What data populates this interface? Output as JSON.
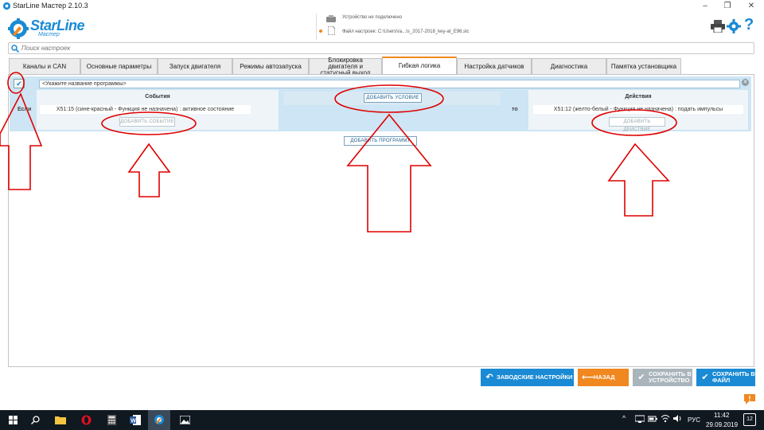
{
  "window": {
    "title": "StarLine Мастер 2.10.3",
    "controls": {
      "minimize": "–",
      "maximize": "❐",
      "close": "✕"
    }
  },
  "brand": {
    "name": "StarLine",
    "subtitle": "Мастер"
  },
  "device": {
    "status": "Устройство не подключено",
    "file_label": "Файл настроек: C:\\Users\\ra...\\s_2017-2018_key-at_E96.slc"
  },
  "search": {
    "placeholder": "Поиск настроек"
  },
  "tabs": [
    {
      "label": "Каналы и CAN"
    },
    {
      "label": "Основные параметры"
    },
    {
      "label": "Запуск двигателя"
    },
    {
      "label": "Режимы автозапуска"
    },
    {
      "label": "Блокировка двигателя и статусный выход"
    },
    {
      "label": "Гибкая логика",
      "active": true
    },
    {
      "label": "Настройка датчиков"
    },
    {
      "label": "Диагностика"
    },
    {
      "label": "Памятка установщика"
    }
  ],
  "program": {
    "name_placeholder": "<Укажите название программы>",
    "if_label": "Если",
    "then_label": "то",
    "events": {
      "header": "События",
      "item": "X51:15 (сине-красный - Функция не назначена) : активное состояние",
      "add_button": "ДОБАВИТЬ СОБЫТИЕ"
    },
    "condition": {
      "add_button": "ДОБАВИТЬ УСЛОВИЕ"
    },
    "actions": {
      "header": "Действия",
      "item": "X51:12 (желто-белый - Функция не назначена) : подать импульсы",
      "add_button": "ДОБАВИТЬ ДЕЙСТВИЕ"
    },
    "add_program_button": "ДОБАВИТЬ ПРОГРАММУ"
  },
  "bottom_buttons": {
    "factory": "ЗАВОДСКИЕ НАСТРОЙКИ",
    "back": "НАЗАД",
    "save_device": "СОХРАНИТЬ В УСТРОЙСТВО",
    "save_file": "СОХРАНИТЬ В ФАЙЛ"
  },
  "taskbar": {
    "language": "РУС",
    "time": "11:42",
    "date": "29.09.2019",
    "notifications": "12"
  },
  "colors": {
    "accent_blue": "#1a8ad4",
    "tab_active_border": "#f0871f",
    "back_orange": "#f0871f",
    "disabled_grey": "#a9b4bb",
    "annotation_red": "#e00000",
    "row_blue": "#cde5f4"
  },
  "icons": {
    "printer": "printer-icon",
    "settings": "gear-icon",
    "help": "question-icon",
    "search": "search-icon",
    "chat": "chat-icon"
  }
}
